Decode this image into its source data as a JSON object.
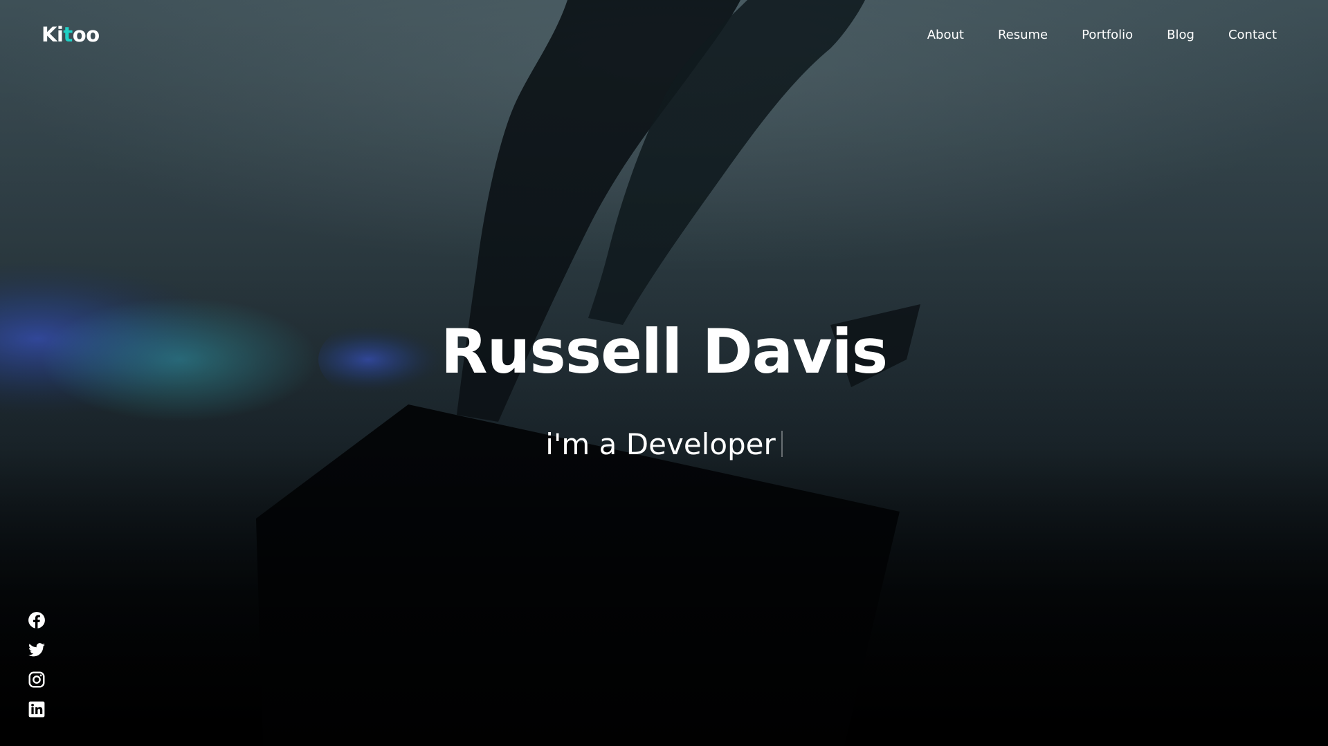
{
  "logo": {
    "text_before_dot": "Ki",
    "text_dotted": "t",
    "text_after": "oo",
    "accent_color": "#1fd1c6"
  },
  "nav": {
    "items": [
      {
        "label": "About"
      },
      {
        "label": "Resume"
      },
      {
        "label": "Portfolio"
      },
      {
        "label": "Blog"
      },
      {
        "label": "Contact"
      }
    ]
  },
  "hero": {
    "name": "Russell Davis",
    "typed_prefix": "i'm a ",
    "typed_role": "Developer"
  },
  "social": {
    "icons": [
      "facebook-icon",
      "twitter-icon",
      "instagram-icon",
      "linkedin-icon"
    ]
  },
  "colors": {
    "text": "#ffffff",
    "background": "#0b1218"
  }
}
